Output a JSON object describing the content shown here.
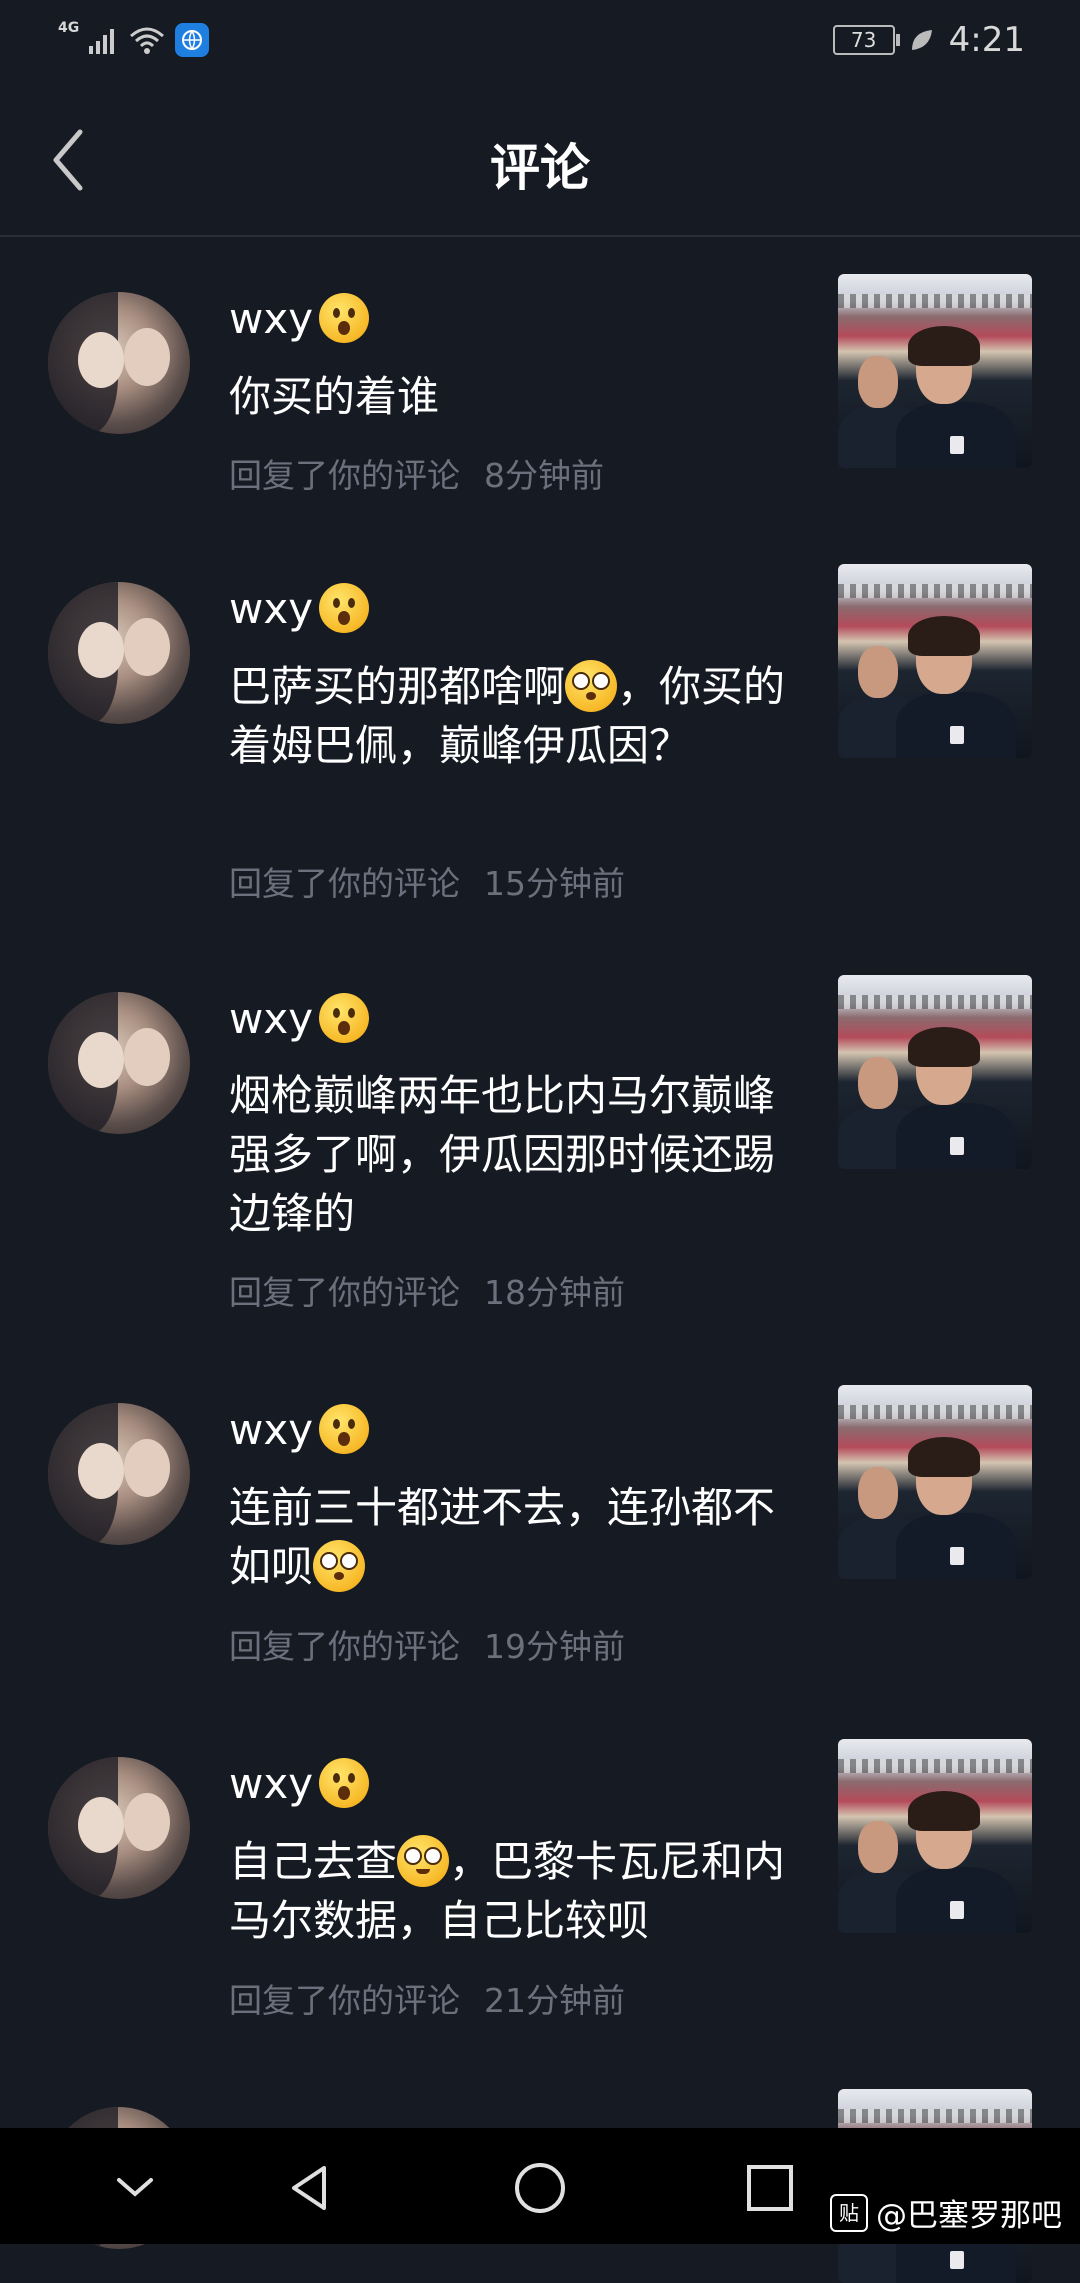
{
  "status_bar": {
    "network": "4G",
    "battery": "73",
    "time": "4:21"
  },
  "header": {
    "title": "评论"
  },
  "comments": [
    {
      "username": "wxy",
      "text": "你买的着谁",
      "action": "回复了你的评论",
      "time": "8分钟前"
    },
    {
      "username": "wxy",
      "text_before_emoji": "巴萨买的那都啥啊",
      "text_after_emoji": "，你买的着姆巴佩，巅峰伊瓜因？",
      "action": "回复了你的评论",
      "time": "15分钟前"
    },
    {
      "username": "wxy",
      "text": "烟枪巅峰两年也比内马尔巅峰强多了啊，伊瓜因那时候还踢边锋的",
      "action": "回复了你的评论",
      "time": "18分钟前"
    },
    {
      "username": "wxy",
      "text_before_emoji": "连前三十都进不去，连孙都不如呗",
      "text_after_emoji": "",
      "action": "回复了你的评论",
      "time": "19分钟前"
    },
    {
      "username": "wxy",
      "text_before_emoji": "自己去查",
      "text_after_emoji": "，巴黎卡瓦尼和内马尔数据，自己比较呗",
      "action": "回复了你的评论",
      "time": "21分钟前"
    }
  ],
  "watermark": {
    "icon_text": "贴",
    "text": "@巴塞罗那吧"
  },
  "icons": {
    "back": "chevron-left-icon",
    "username_emoji": "surprised-face-emoji",
    "inline_emoji_dizzy": "dizzy-face-emoji",
    "inline_emoji_blush": "flushed-face-emoji"
  }
}
